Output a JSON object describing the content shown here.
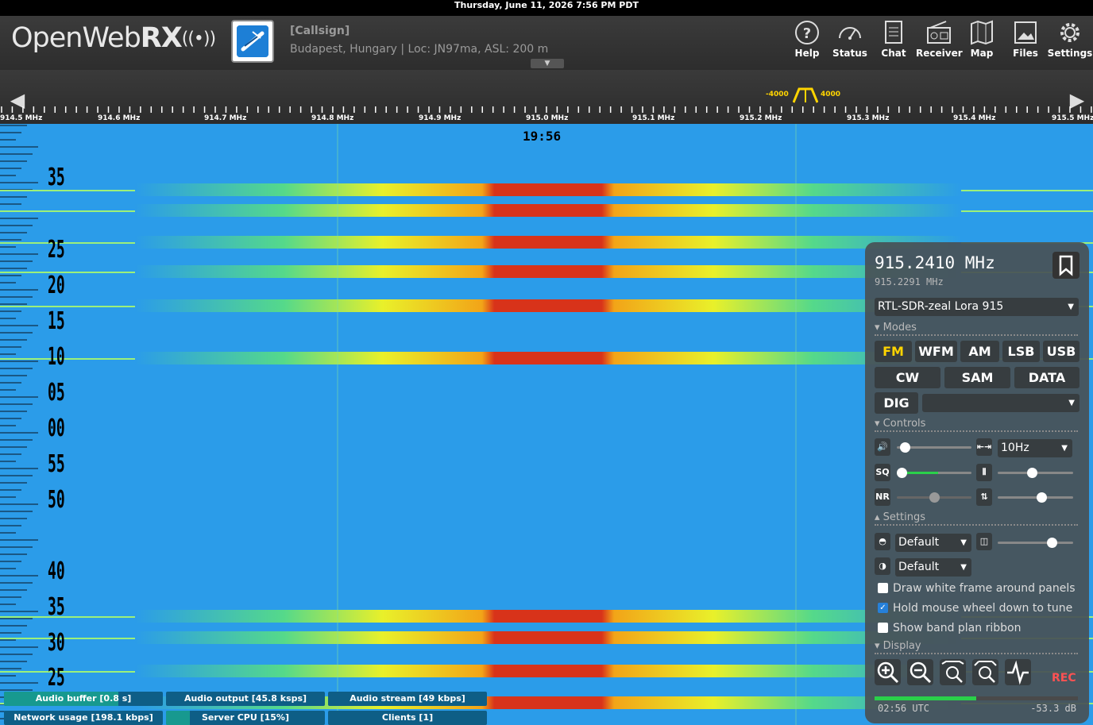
{
  "os_bar": {
    "datetime": "Thursday, June 11, 2026  7:56 PM PDT"
  },
  "header": {
    "logo_text_main": "OpenWeb",
    "logo_text_bold": "RX",
    "callsign": "[Callsign]",
    "location": "Budapest, Hungary | Loc: JN97ma, ASL: 200 m",
    "nav": [
      {
        "label": "Help",
        "icon": "help-icon"
      },
      {
        "label": "Status",
        "icon": "gauge-icon"
      },
      {
        "label": "Chat",
        "icon": "chat-icon"
      },
      {
        "label": "Receiver",
        "icon": "radio-icon"
      },
      {
        "label": "Map",
        "icon": "map-icon"
      },
      {
        "label": "Files",
        "icon": "image-icon"
      },
      {
        "label": "Settings",
        "icon": "gear-icon"
      }
    ]
  },
  "scale": {
    "labels": [
      "914.5 MHz",
      "914.6 MHz",
      "914.7 MHz",
      "914.8 MHz",
      "914.9 MHz",
      "915.0 MHz",
      "915.1 MHz",
      "915.2 MHz",
      "915.3 MHz",
      "915.4 MHz",
      "915.5 MHz"
    ],
    "bandwidth_low": "-4000",
    "bandwidth_high": "4000"
  },
  "waterfall": {
    "current_time": "19:56",
    "time_labels": [
      "35",
      "25",
      "20",
      "15",
      "10",
      "05",
      "00",
      "55",
      "50",
      "40",
      "35",
      "30",
      "25"
    ]
  },
  "status_bars": [
    {
      "label": "Audio buffer [0.8 s]",
      "level": 0.72
    },
    {
      "label": "Audio output [45.8 ksps]",
      "level": 0.0
    },
    {
      "label": "Audio stream [49 kbps]",
      "level": 0.0
    },
    {
      "label": "Network usage [198.1 kbps]",
      "level": 0.0
    },
    {
      "label": "Server CPU [15%]",
      "level": 0.15
    },
    {
      "label": "Clients [1]",
      "level": 0.0
    }
  ],
  "panel": {
    "frequency": "915.2410 MHz",
    "frequency_secondary": "915.2291 MHz",
    "profile": "RTL-SDR-zeal Lora 915",
    "sections": {
      "modes": "Modes",
      "controls": "Controls",
      "settings": "Settings",
      "display": "Display"
    },
    "modes_row1": [
      "FM",
      "WFM",
      "AM",
      "LSB",
      "USB"
    ],
    "modes_row2": [
      "CW",
      "SAM",
      "DATA"
    ],
    "dig_label": "DIG",
    "dig_select": "",
    "active_mode": "FM",
    "step_select": "10Hz",
    "ctl_labels": {
      "sq": "SQ",
      "nr": "NR"
    },
    "volume_level": 0.05,
    "squelch_level": 0.0,
    "nr_level": 0.5,
    "gain_level": 0.45,
    "agc_level": 0.6,
    "theme_select": "Default",
    "contrast_select": "Default",
    "zoom_level": 0.75,
    "checkboxes": [
      {
        "label": "Draw white frame around panels",
        "checked": false
      },
      {
        "label": "Hold mouse wheel down to tune",
        "checked": true
      },
      {
        "label": "Show band plan ribbon",
        "checked": false
      }
    ],
    "rec_label": "REC",
    "smeter_level": 0.5,
    "utc_time": "02:56 UTC",
    "db_value": "-53.3 dB"
  },
  "colors": {
    "accent": "#ffd400",
    "waterfall_bg": "#2b9ce9",
    "signal_red": "#d8331a",
    "signal_yellow": "#f2e826",
    "signal_green": "#4fd86a"
  }
}
